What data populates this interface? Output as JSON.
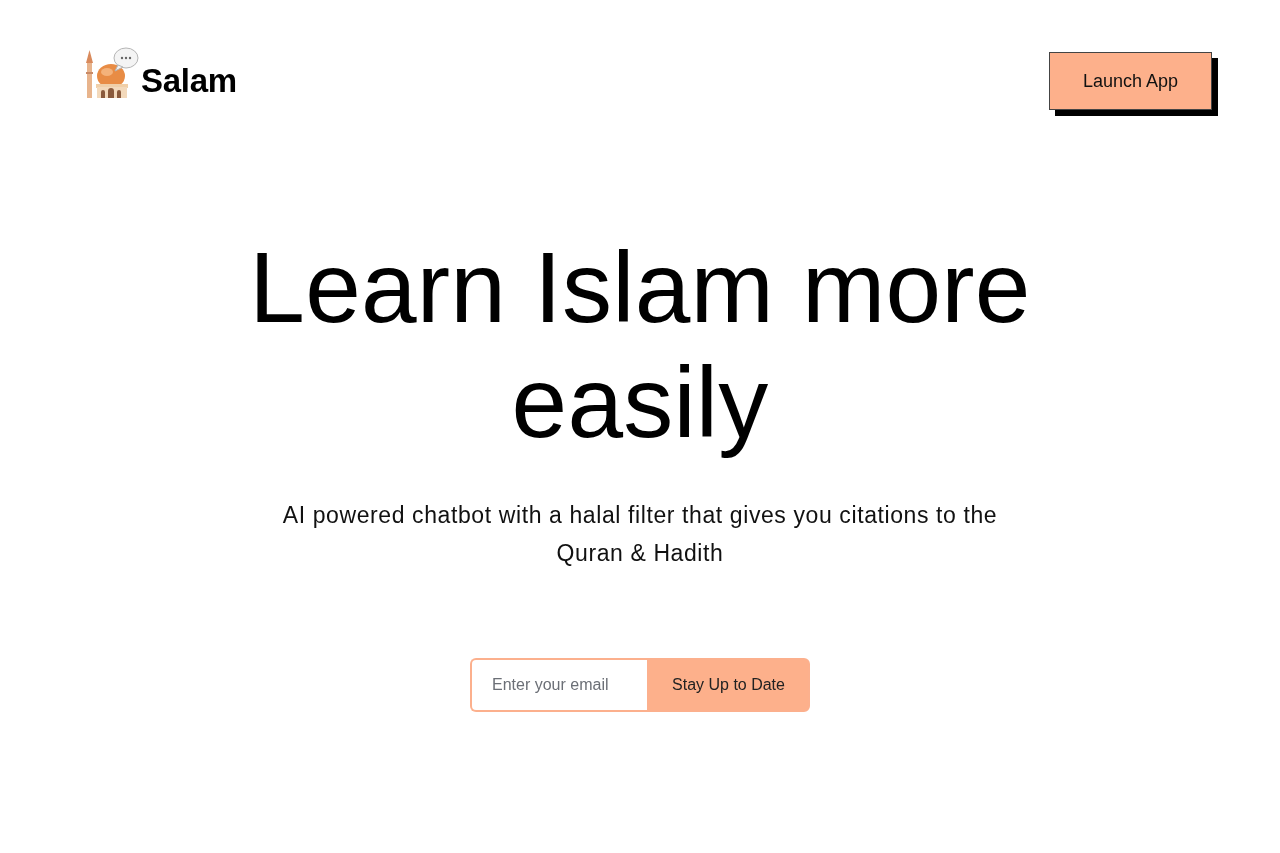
{
  "header": {
    "brand": {
      "name": "Salam"
    },
    "launch_button": {
      "label": "Launch App"
    }
  },
  "hero": {
    "title": "Learn Islam more easily",
    "subtitle": "AI powered chatbot with a halal filter that gives you citations to the Quran & Hadith"
  },
  "signup": {
    "email_field": {
      "placeholder": "Enter your email"
    },
    "submit_button": {
      "label": "Stay Up to Date"
    }
  }
}
